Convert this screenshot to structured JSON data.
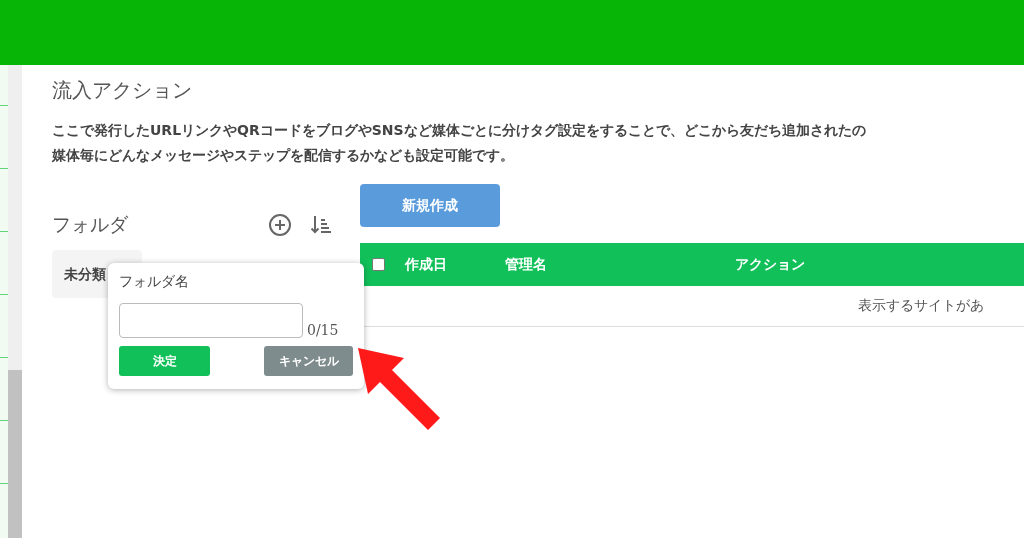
{
  "page": {
    "title": "流入アクション",
    "description_lines": [
      "ここで発行したURLリンクやQRコードをブログやSNSなど媒体ごとに分けタグ設定をすることで、どこから友だち追加されたの",
      "媒体毎にどんなメッセージやステップを配信するかなども設定可能です。"
    ]
  },
  "folders": {
    "heading": "フォルダ",
    "items": [
      {
        "label": "未分類"
      }
    ]
  },
  "popup": {
    "label": "フォルダ名",
    "counter": "0/15",
    "buttons": [
      {
        "label": "決定",
        "kind": "primary"
      },
      {
        "label": "キャンセル",
        "kind": "secondary"
      }
    ]
  },
  "new_button": "新規作成",
  "table": {
    "select_all": {
      "checked": false
    },
    "columns": [
      "作成日",
      "管理名",
      "アクション"
    ],
    "empty_message": "表示するサイトがあ"
  }
}
